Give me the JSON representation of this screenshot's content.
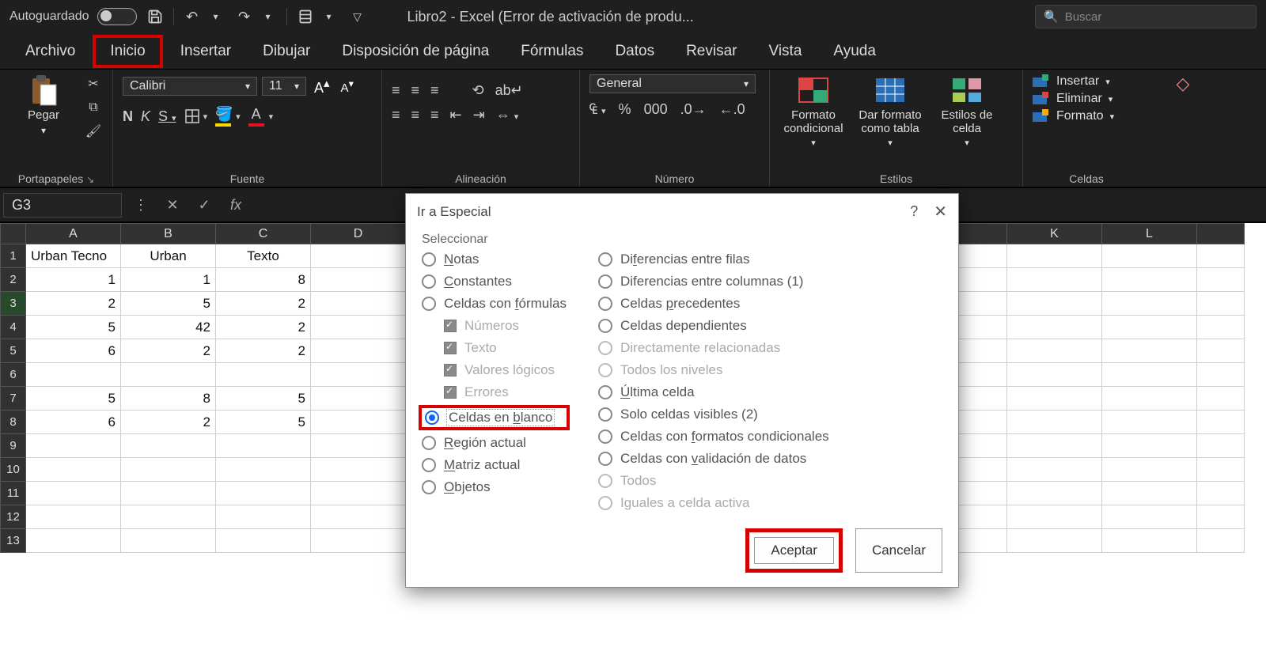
{
  "titlebar": {
    "autosave": "Autoguardado",
    "title": "Libro2  -  Excel (Error de activación de produ...",
    "search_placeholder": "Buscar"
  },
  "tabs": [
    "Archivo",
    "Inicio",
    "Insertar",
    "Dibujar",
    "Disposición de página",
    "Fórmulas",
    "Datos",
    "Revisar",
    "Vista",
    "Ayuda"
  ],
  "active_tab": 1,
  "ribbon": {
    "paste": "Pegar",
    "clipboard_label": "Portapapeles",
    "font_name": "Calibri",
    "font_size": "11",
    "font_label": "Fuente",
    "bold": "N",
    "italic": "K",
    "underline": "S",
    "align_label": "Alineación",
    "number_format": "General",
    "number_label": "Número",
    "cond_format": "Formato condicional",
    "format_table": "Dar formato como tabla",
    "cell_styles": "Estilos de celda",
    "styles_label": "Estilos",
    "insert": "Insertar",
    "delete": "Eliminar",
    "format": "Formato",
    "cells_label": "Celdas"
  },
  "formula_bar": {
    "name": "G3",
    "fx": "fx"
  },
  "columns": [
    "A",
    "B",
    "C",
    "D",
    "K",
    "L"
  ],
  "rows": [
    {
      "n": 1,
      "A": "Urban Tecno",
      "B": "Urban",
      "C": "Texto"
    },
    {
      "n": 2,
      "A": "1",
      "B": "1",
      "C": "8"
    },
    {
      "n": 3,
      "A": "2",
      "B": "5",
      "C": "2"
    },
    {
      "n": 4,
      "A": "5",
      "B": "42",
      "C": "2"
    },
    {
      "n": 5,
      "A": "6",
      "B": "2",
      "C": "2"
    },
    {
      "n": 6,
      "A": "",
      "B": "",
      "C": ""
    },
    {
      "n": 7,
      "A": "5",
      "B": "8",
      "C": "5"
    },
    {
      "n": 8,
      "A": "6",
      "B": "2",
      "C": "5"
    },
    {
      "n": 9
    },
    {
      "n": 10
    },
    {
      "n": 11
    },
    {
      "n": 12
    },
    {
      "n": 13
    }
  ],
  "dialog": {
    "title": "Ir a Especial",
    "section": "Seleccionar",
    "left": [
      {
        "t": "radio",
        "label": "Notas",
        "u": "N"
      },
      {
        "t": "radio",
        "label": "Constantes",
        "u": "C"
      },
      {
        "t": "radio",
        "label": "Celdas con fórmulas",
        "u": "f"
      },
      {
        "t": "chk",
        "label": "Números",
        "sub": true,
        "dis": true
      },
      {
        "t": "chk",
        "label": "Texto",
        "sub": true,
        "dis": true
      },
      {
        "t": "chk",
        "label": "Valores lógicos",
        "sub": true,
        "dis": true
      },
      {
        "t": "chk",
        "label": "Errores",
        "sub": true,
        "dis": true
      },
      {
        "t": "radio",
        "label": "Celdas en blanco",
        "u": "b",
        "checked": true,
        "hl": true
      },
      {
        "t": "radio",
        "label": "Región actual",
        "u": "R"
      },
      {
        "t": "radio",
        "label": "Matriz actual",
        "u": "M"
      },
      {
        "t": "radio",
        "label": "Objetos",
        "u": "O"
      }
    ],
    "right": [
      {
        "t": "radio",
        "label": "Diferencias entre filas",
        "u": "f"
      },
      {
        "t": "radio",
        "label": "Diferencias entre columnas (1)"
      },
      {
        "t": "radio",
        "label": "Celdas precedentes",
        "u": "p"
      },
      {
        "t": "radio",
        "label": "Celdas dependientes"
      },
      {
        "t": "subradio",
        "label": "Directamente relacionadas",
        "dis": true
      },
      {
        "t": "subradio",
        "label": "Todos los niveles",
        "dis": true
      },
      {
        "t": "radio",
        "label": "Última celda",
        "u": "Ú"
      },
      {
        "t": "radio",
        "label": "Solo celdas visibles (2)"
      },
      {
        "t": "radio",
        "label": "Celdas con formatos condicionales",
        "u": "f"
      },
      {
        "t": "radio",
        "label": "Celdas con validación de datos",
        "u": "v"
      },
      {
        "t": "subradio",
        "label": "Todos",
        "dis": true
      },
      {
        "t": "subradio",
        "label": "Iguales a celda activa",
        "dis": true
      }
    ],
    "ok": "Aceptar",
    "cancel": "Cancelar"
  }
}
